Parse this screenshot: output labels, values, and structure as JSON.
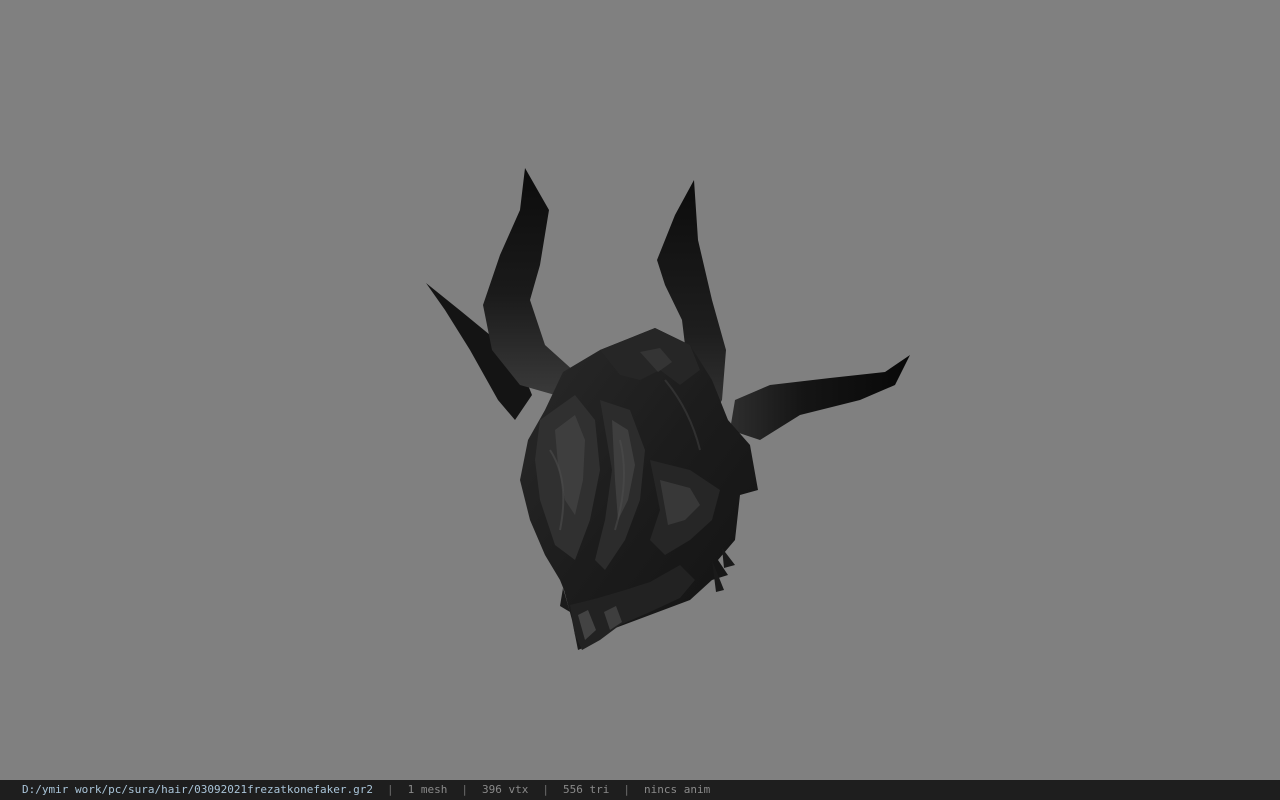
{
  "viewport": {
    "background_color": "#808080",
    "model": {
      "description_icon": "horned-helmet-model",
      "base_color": "#1a1a1a",
      "highlight_color": "#5a5a5a"
    }
  },
  "status_bar": {
    "file_path": "D:/ymir work/pc/sura/hair/03092021frezatkonefaker.gr2",
    "separator": "|",
    "mesh_count": "1 mesh",
    "vertex_count": "396 vtx",
    "triangle_count": "556 tri",
    "anim_status": "nincs anim",
    "background_color": "#1e1e1e",
    "path_color": "#a9c4d8",
    "text_color": "#8a8a8a"
  }
}
